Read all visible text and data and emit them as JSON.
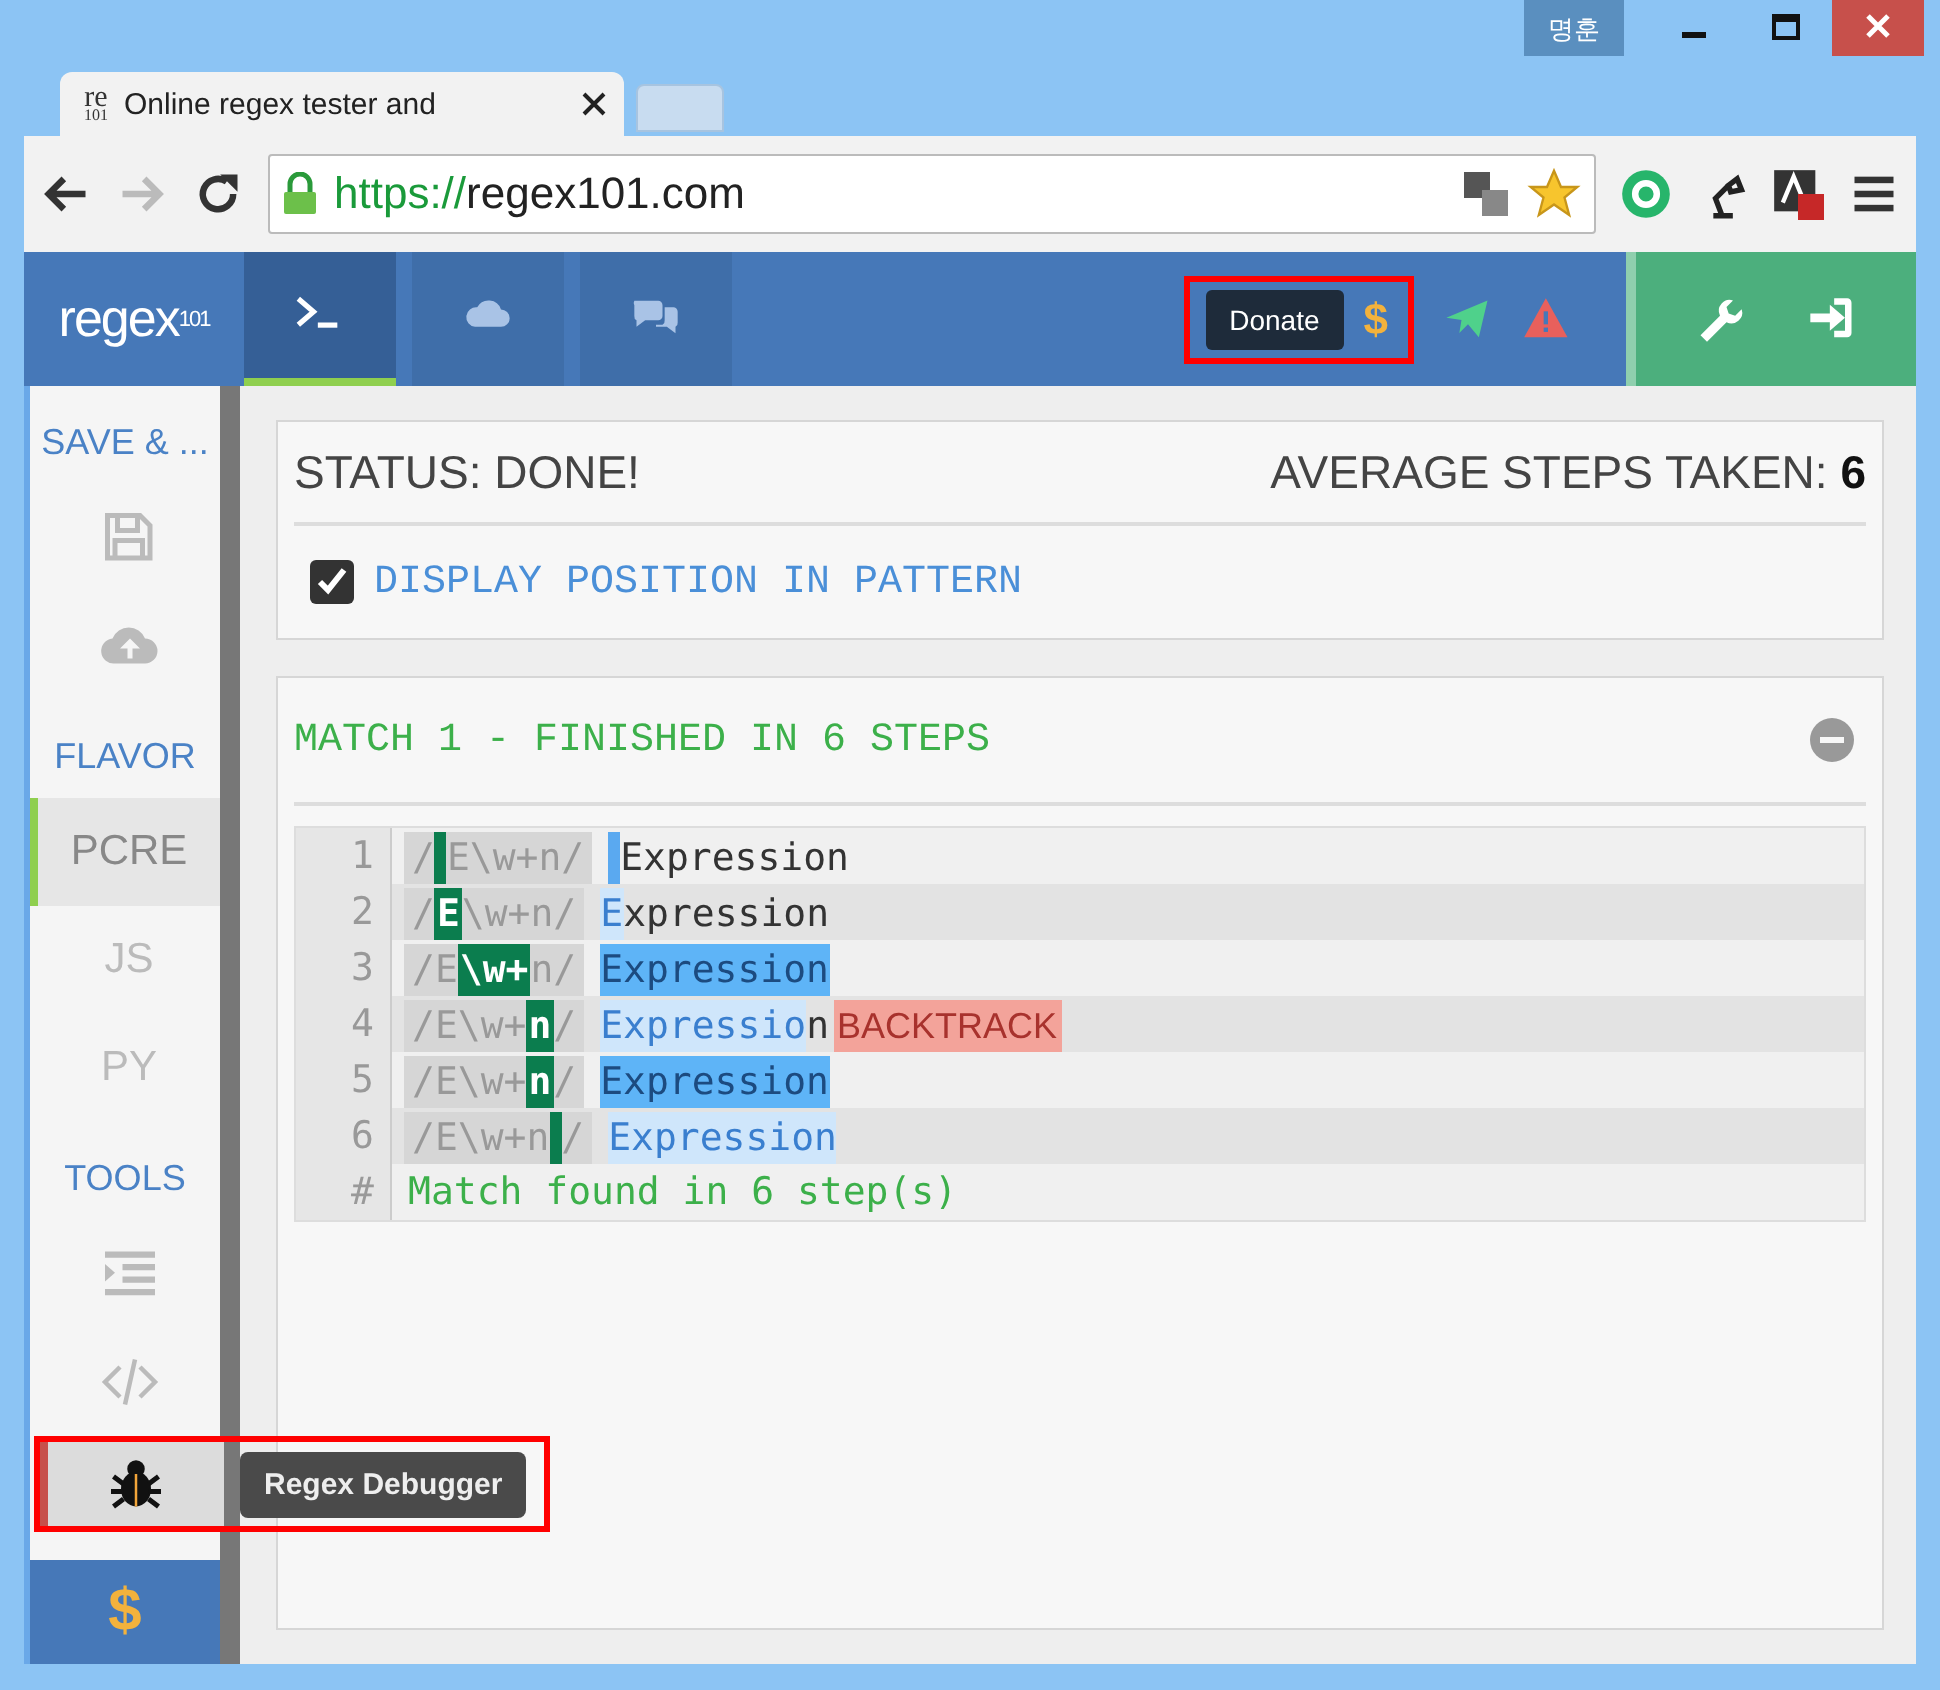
{
  "window": {
    "user_badge": "명훈"
  },
  "browser": {
    "tab_title": "Online regex tester and",
    "favicon": "re",
    "favicon_sub": "101",
    "url_scheme": "https://",
    "url_host": "regex101.com"
  },
  "header": {
    "logo": "regex",
    "logo_sub": "101",
    "tabs": [
      {
        "kind": "terminal",
        "selected": true
      },
      {
        "kind": "cloud",
        "selected": false
      },
      {
        "kind": "chat",
        "selected": false
      }
    ],
    "donate": {
      "tooltip": "Donate",
      "symbol": "$",
      "highlighted": true
    },
    "actions": [
      {
        "kind": "plane"
      },
      {
        "kind": "warning"
      }
    ],
    "settings": [
      {
        "kind": "wrench"
      },
      {
        "kind": "signin"
      }
    ]
  },
  "sidebar": {
    "sections": [
      {
        "heading": "SAVE & ...",
        "items": [
          {
            "kind": "save",
            "selected": false
          },
          {
            "kind": "upload",
            "selected": false
          }
        ]
      },
      {
        "heading": "FLAVOR",
        "items": [
          {
            "kind": "text",
            "label": "PCRE",
            "selected": true
          },
          {
            "kind": "text",
            "label": "JS",
            "selected": false
          },
          {
            "kind": "text",
            "label": "PY",
            "selected": false
          }
        ]
      },
      {
        "heading": "TOOLS",
        "items": [
          {
            "kind": "format",
            "selected": false
          },
          {
            "kind": "code",
            "selected": false
          },
          {
            "kind": "bug",
            "selected": true,
            "tooltip": "Regex Debugger",
            "highlighted": true
          }
        ]
      }
    ],
    "footer_symbol": "$"
  },
  "status": {
    "label": "STATUS: DONE!",
    "steps_label": "AVERAGE STEPS TAKEN:",
    "steps_value": "6"
  },
  "options": [
    {
      "label": "DISPLAY POSITION IN PATTERN",
      "checked": true
    }
  ],
  "match": {
    "title": "MATCH 1 - FINISHED IN 6 STEPS",
    "steps": [
      {
        "number": "1",
        "pattern": [
          {
            "kind": "text",
            "text": "/"
          },
          {
            "kind": "cursor"
          },
          {
            "kind": "text",
            "text": "E\\w+n/"
          }
        ],
        "subject": [
          {
            "kind": "cursor"
          },
          {
            "kind": "text",
            "text": "Expression"
          }
        ]
      },
      {
        "number": "2",
        "pattern": [
          {
            "kind": "text",
            "text": "/"
          },
          {
            "kind": "token",
            "text": "E"
          },
          {
            "kind": "text",
            "text": "\\w+n/"
          }
        ],
        "subject": [
          {
            "kind": "light",
            "text": "E"
          },
          {
            "kind": "text",
            "text": "xpression"
          }
        ]
      },
      {
        "number": "3",
        "pattern": [
          {
            "kind": "text",
            "text": "/E"
          },
          {
            "kind": "token",
            "text": "\\w+"
          },
          {
            "kind": "text",
            "text": "n/"
          }
        ],
        "subject": [
          {
            "kind": "strong",
            "text": "Expression"
          }
        ]
      },
      {
        "number": "4",
        "pattern": [
          {
            "kind": "text",
            "text": "/E\\w+"
          },
          {
            "kind": "token",
            "text": "n"
          },
          {
            "kind": "text",
            "text": "/"
          }
        ],
        "subject": [
          {
            "kind": "light",
            "text": "Expressio"
          },
          {
            "kind": "text",
            "text": "n"
          },
          {
            "kind": "backtrack",
            "text": "BACKTRACK"
          }
        ]
      },
      {
        "number": "5",
        "pattern": [
          {
            "kind": "text",
            "text": "/E\\w+"
          },
          {
            "kind": "token",
            "text": "n"
          },
          {
            "kind": "text",
            "text": "/"
          }
        ],
        "subject": [
          {
            "kind": "strong",
            "text": "Expression"
          }
        ]
      },
      {
        "number": "6",
        "pattern": [
          {
            "kind": "text",
            "text": "/E\\w+n"
          },
          {
            "kind": "cursor"
          },
          {
            "kind": "text",
            "text": "/"
          }
        ],
        "subject": [
          {
            "kind": "light",
            "text": "Expression"
          }
        ]
      }
    ],
    "summary": {
      "number": "#",
      "text": "Match found in 6 step(s)"
    }
  }
}
